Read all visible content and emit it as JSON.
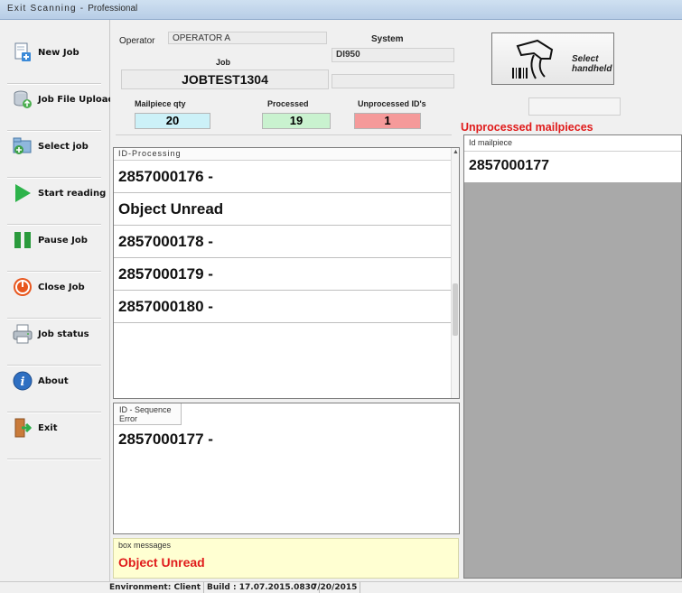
{
  "window": {
    "title_spaced": "Exit Scanning - ",
    "title_tail": "Professional"
  },
  "sidebar": {
    "items": [
      {
        "label": "New Job",
        "icon": "new-job-icon"
      },
      {
        "label": "Job File Upload",
        "icon": "database-upload-icon"
      },
      {
        "label": "Select job",
        "icon": "select-job-icon"
      },
      {
        "label": "Start reading",
        "icon": "play-icon"
      },
      {
        "label": "Pause Job",
        "icon": "pause-icon"
      },
      {
        "label": "Close Job",
        "icon": "power-icon"
      },
      {
        "label": "Job status",
        "icon": "printer-icon"
      },
      {
        "label": "About",
        "icon": "info-icon"
      },
      {
        "label": "Exit",
        "icon": "exit-door-icon"
      }
    ]
  },
  "header": {
    "operator_label": "Operator",
    "operator_value": "OPERATOR A",
    "system_label": "System",
    "system_value": "DI950",
    "job_label": "Job",
    "job_value": "JOBTEST1304",
    "counts": {
      "mailpiece_label": "Mailpiece qty",
      "mailpiece_value": "20",
      "processed_label": "Processed",
      "processed_value": "19",
      "unprocessed_label": "Unprocessed ID's",
      "unprocessed_value": "1"
    }
  },
  "handheld": {
    "label": "Select handheld"
  },
  "unprocessed": {
    "title": "Unprocessed mailpieces",
    "column": "Id mailpiece",
    "rows": [
      "2857000177"
    ]
  },
  "processing": {
    "header": "ID-Processing",
    "rows": [
      "2857000176 -",
      "Object Unread",
      "2857000178 -",
      "2857000179 -",
      "2857000180 -"
    ]
  },
  "sequence": {
    "header": "ID - Sequence Error",
    "rows": [
      "2857000177 -"
    ]
  },
  "messages": {
    "header": "box messages",
    "value": "Object Unread"
  },
  "statusbar": {
    "environment": "Environment: Client",
    "build": "Build : 17.07.2015.0830",
    "date": "7/20/2015"
  },
  "colors": {
    "mailpiece_bg": "#ccf1f8",
    "processed_bg": "#c9f2cf",
    "unprocessed_bg": "#f59a9a",
    "alert_red": "#e01b1b"
  }
}
